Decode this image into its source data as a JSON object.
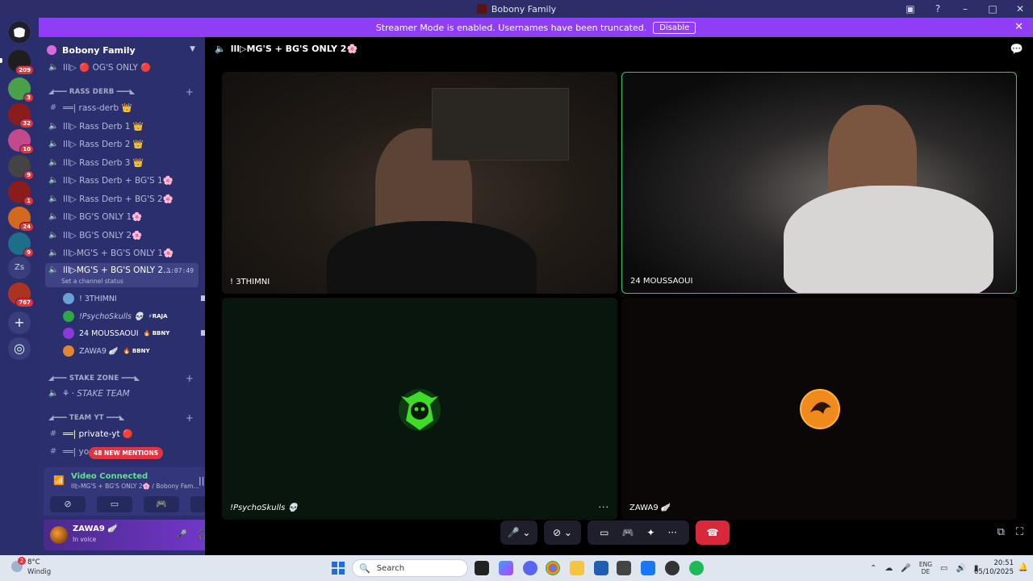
{
  "window": {
    "title": "Bobony Family"
  },
  "banner": {
    "text": "Streamer Mode is enabled. Usernames have been truncated.",
    "button": "Disable"
  },
  "rail": {
    "servers": [
      {
        "badge": "209",
        "color": "#1e1e1e"
      },
      {
        "badge": "3",
        "color": "#4aa04a"
      },
      {
        "badge": "32",
        "color": "#8a1c1c"
      },
      {
        "badge": "10",
        "color": "#c24a8a"
      },
      {
        "badge": "9",
        "color": "#444444"
      },
      {
        "badge": "1",
        "color": "#8a1c1c"
      },
      {
        "badge": "24",
        "color": "#d2691e"
      },
      {
        "badge": "9",
        "color": "#1e6e8a"
      },
      {
        "badge": "767",
        "color": "#aa3322"
      }
    ],
    "zs_label": "Zs",
    "add_icon": "plus-icon",
    "explore_icon": "compass-icon"
  },
  "sidebar": {
    "server_name": "Bobony Family",
    "top_channel": "lll▷ 🔴 OG'S ONLY 🔴",
    "categories": {
      "rass_derb": "◢━━━ RASS DERB ━━━◣",
      "stake_zone": "◢━━━ STAKE ZONE ━━━◣",
      "team_yt": "◢━━━ TEAM YT ━━━◣"
    },
    "channels": [
      {
        "icon": "#",
        "label": "══| rass-derb 👑"
      },
      {
        "icon": "speaker",
        "label": "lll▷ Rass Derb 1 👑"
      },
      {
        "icon": "speaker",
        "label": "lll▷ Rass Derb 2 👑"
      },
      {
        "icon": "speaker",
        "label": "lll▷ Rass Derb 3 👑"
      },
      {
        "icon": "speaker",
        "label": "lll▷ Rass Derb + BG'S 1🌸"
      },
      {
        "icon": "speaker",
        "label": "lll▷ Rass Derb + BG'S 2🌸"
      },
      {
        "icon": "speaker",
        "label": "lll▷ BG'S ONLY 1🌸"
      },
      {
        "icon": "speaker",
        "label": "lll▷ BG'S ONLY 2🌸"
      },
      {
        "icon": "speaker",
        "label": "lll▷MG'S + BG'S ONLY 1🌸"
      }
    ],
    "active_channel": {
      "label": "lll▷MG'S + BG'S ONLY 2...",
      "status": "Set a channel status",
      "timer": "3:07:49"
    },
    "voice_users": [
      {
        "name": "! 3THIMNI",
        "tag": "",
        "color": "#6aa0d8"
      },
      {
        "name": "!PsychoSkulls 💀",
        "tag": "⚡RAJA",
        "color": "#2fa84a"
      },
      {
        "name": "24 MOUSSAOUI",
        "tag": "🔥 BBNY",
        "color": "#8a3ad6"
      },
      {
        "name": "ZAWA9 🪽",
        "tag": "🔥 BBNY",
        "color": "#e0872f"
      }
    ],
    "stake_team": "⚘ · STAKE TEAM",
    "private_yt": "══| private-yt 🔴",
    "yo_channel": "══| yo",
    "mentions": "48 NEW MENTIONS"
  },
  "voice_panel": {
    "title": "Video Connected",
    "subtitle": "lll▷MG'S + BG'S ONLY 2🌸 / Bobony Fam..."
  },
  "user_panel": {
    "name": "ZAWA9 🪽",
    "status": "In voice"
  },
  "main": {
    "channel_title": "lll▷MG'S + BG'S ONLY 2🌸",
    "tiles": [
      {
        "name": "! 3THIMNI"
      },
      {
        "name": "24 MOUSSAOUI"
      },
      {
        "name": "!PsychoSkulls 💀"
      },
      {
        "name": "ZAWA9 🪽"
      }
    ],
    "more": "···"
  },
  "taskbar": {
    "weather_temp": "8°C",
    "weather_cond": "Windig",
    "weather_badge": "2",
    "search_placeholder": "Search",
    "lang_top": "ENG",
    "lang_bottom": "DE",
    "time": "20:51",
    "date": "05/10/2025"
  }
}
